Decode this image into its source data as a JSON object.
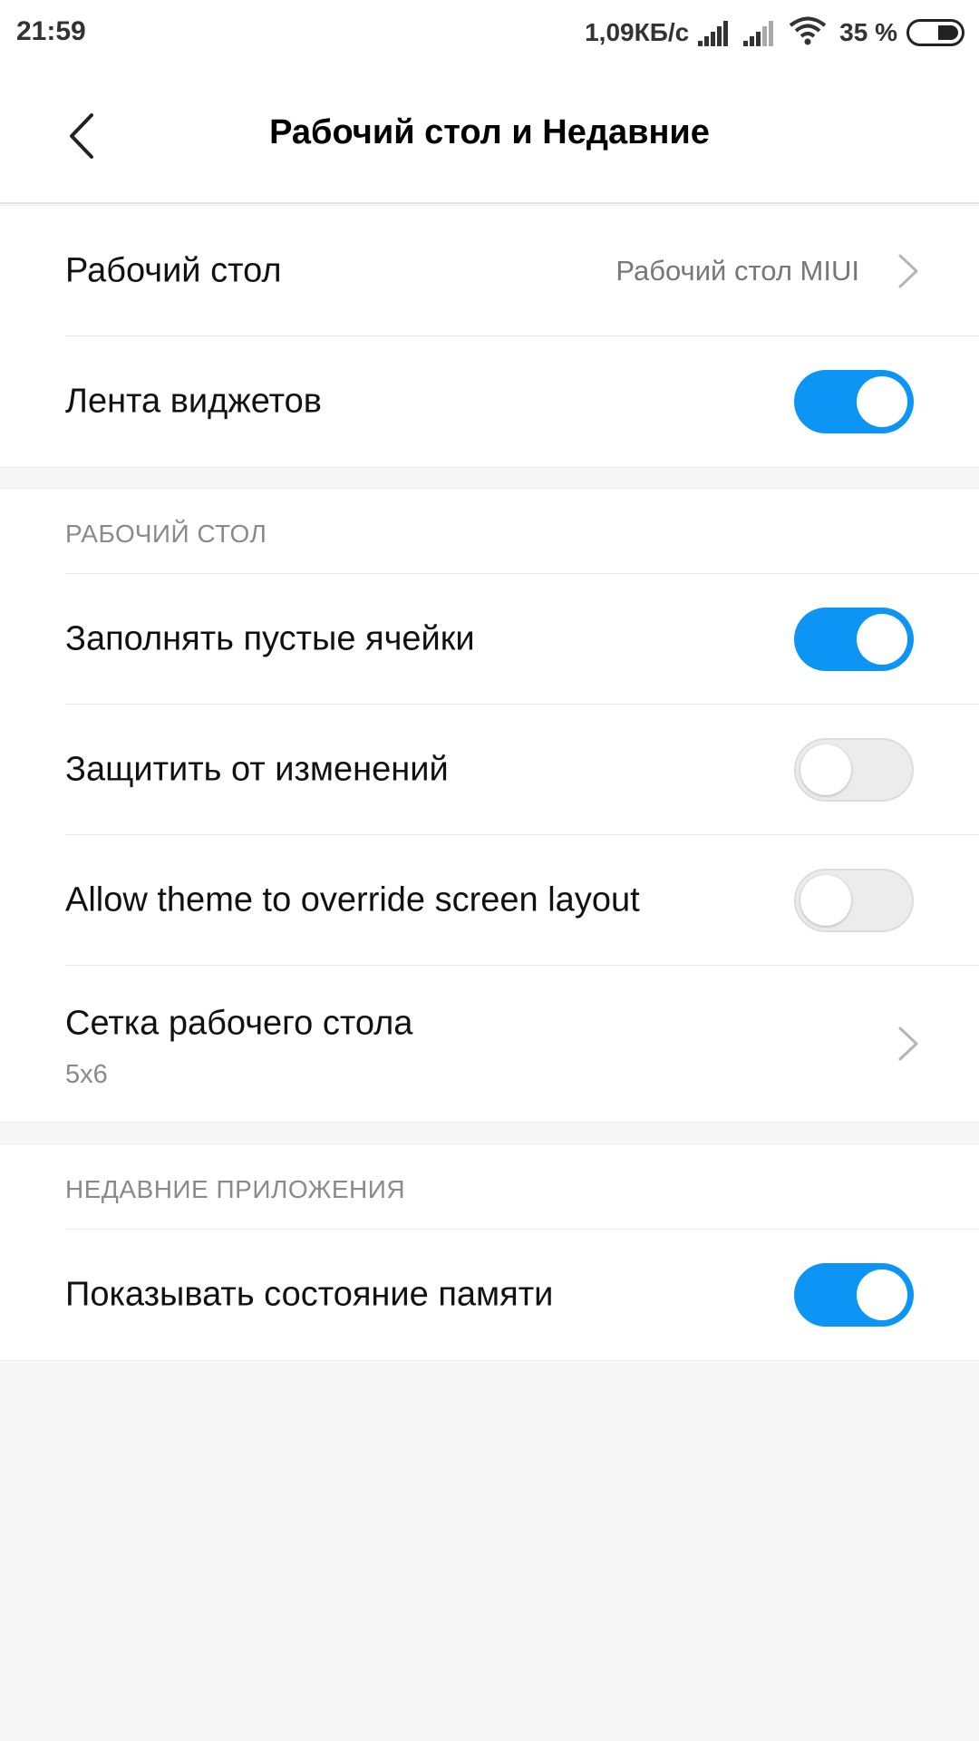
{
  "status_bar": {
    "time": "21:59",
    "net_speed": "1,09КБ/с",
    "battery_percent": "35 %",
    "icons": [
      "signal-icon",
      "signal-icon",
      "wifi-icon",
      "battery-icon"
    ]
  },
  "app_bar": {
    "title": "Рабочий стол и Недавние",
    "back_icon": "chevron-left-icon"
  },
  "section_main": {
    "items": [
      {
        "label": "Рабочий стол",
        "value": "Рабочий стол MIUI",
        "type": "link"
      },
      {
        "label": "Лента виджетов",
        "type": "toggle",
        "checked": true
      }
    ]
  },
  "section_desktop": {
    "header": "РАБОЧИЙ СТОЛ",
    "items": [
      {
        "label": "Заполнять пустые ячейки",
        "type": "toggle",
        "checked": true
      },
      {
        "label": "Защитить от изменений",
        "type": "toggle",
        "checked": false
      },
      {
        "label": "Allow theme to override screen layout",
        "type": "toggle",
        "checked": false
      },
      {
        "label": "Сетка рабочего стола",
        "sub": "5x6",
        "type": "link"
      }
    ]
  },
  "section_recents": {
    "header": "НЕДАВНИЕ ПРИЛОЖЕНИЯ",
    "items": [
      {
        "label": "Показывать состояние памяти",
        "type": "toggle",
        "checked": true
      }
    ]
  },
  "colors": {
    "accent": "#0d95f5",
    "background": "#f7f7f7",
    "secondary_text": "#8a8a8a"
  }
}
